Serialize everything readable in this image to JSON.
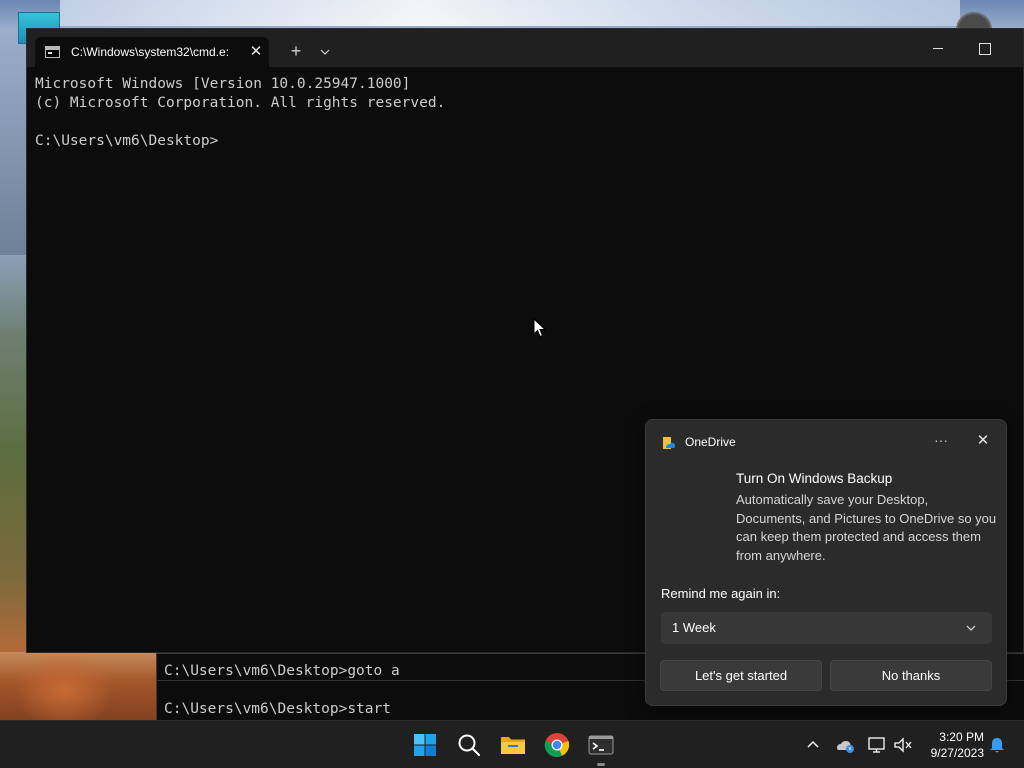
{
  "terminal": {
    "tab_title": "C:\\Windows\\system32\\cmd.e:",
    "lines": [
      "Microsoft Windows [Version 10.0.25947.1000]",
      "(c) Microsoft Corporation. All rights reserved.",
      "",
      "C:\\Users\\vm6\\Desktop>"
    ]
  },
  "background_cmd": {
    "line1": "C:\\Users\\vm6\\Desktop>goto a",
    "line2": "C:\\Users\\vm6\\Desktop>start"
  },
  "notification": {
    "app_name": "OneDrive",
    "heading": "Turn On Windows Backup",
    "body": "Automatically save your Desktop, Documents, and Pictures to OneDrive so you can keep them protected and access them from anywhere.",
    "remind_label": "Remind me again in:",
    "remind_value": "1 Week",
    "primary_button": "Let's get started",
    "secondary_button": "No thanks",
    "more_label": "···",
    "close_label": "✕"
  },
  "taskbar": {
    "time": "3:20 PM",
    "date": "9/27/2023",
    "apps": [
      "start-icon",
      "search-icon",
      "file-explorer-icon",
      "chrome-icon",
      "terminal-icon"
    ],
    "tray": [
      "chevron-up-icon",
      "onedrive-icon",
      "network-icon",
      "volume-muted-icon",
      "notification-bell-icon"
    ]
  },
  "colors": {
    "terminal_bg": "#0c0c0c",
    "terminal_text": "#cccccc",
    "toast_bg": "#2b2b2b",
    "taskbar_bg": "#202020",
    "accent": "#0078d4"
  }
}
